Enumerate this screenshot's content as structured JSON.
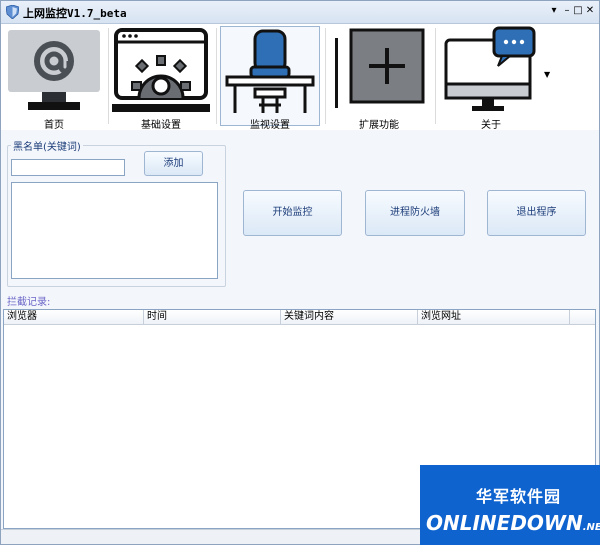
{
  "window": {
    "title": "上网监控V1.7_beta",
    "controls": [
      "▾",
      "–",
      "□",
      "✕"
    ]
  },
  "toolbar": {
    "items": [
      {
        "label": "首页",
        "icon": "email-at-monitor-icon"
      },
      {
        "label": "基础设置",
        "icon": "gear-browser-icon"
      },
      {
        "label": "监视设置",
        "icon": "chair-desk-icon"
      },
      {
        "label": "扩展功能",
        "icon": "plus-box-icon"
      },
      {
        "label": "关于",
        "icon": "chat-monitor-icon"
      }
    ],
    "more_icon": "dropdown-arrow-icon"
  },
  "blacklist": {
    "label": "黑名单(关键词)",
    "input_value": "",
    "add_button": "添加"
  },
  "actions": {
    "start": "开始监控",
    "firewall": "进程防火墙",
    "exit": "退出程序"
  },
  "log": {
    "label": "拦截记录:",
    "columns": [
      "浏览器",
      "时间",
      "关键词内容",
      "浏览网址"
    ],
    "rows": []
  },
  "watermark": {
    "line1": "华军软件园",
    "line2": "ONLINEDOWN",
    "suffix": ".NET"
  }
}
